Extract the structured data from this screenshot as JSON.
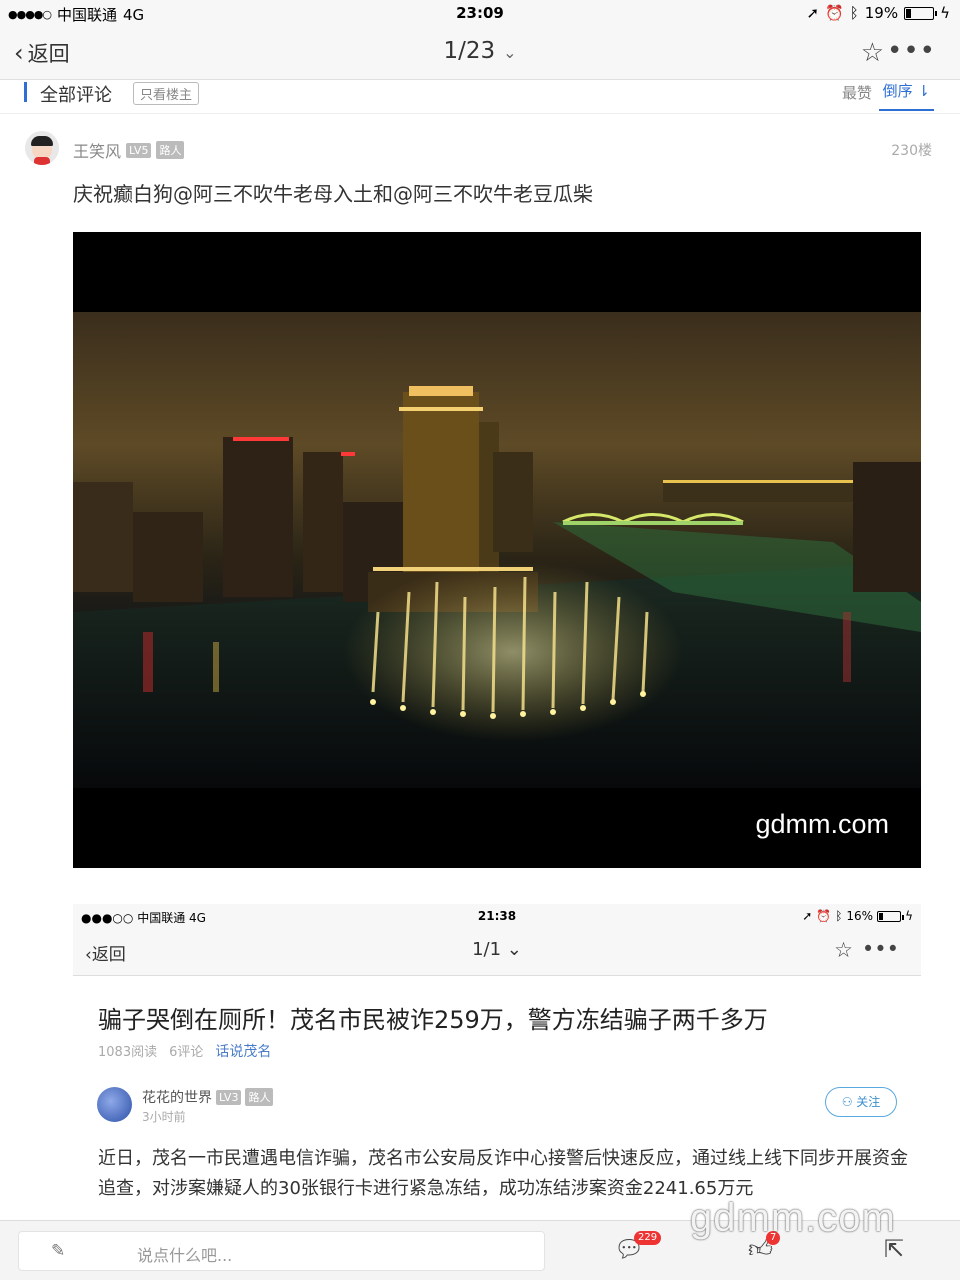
{
  "status_bar": {
    "signal_dots": "●●●●○",
    "carrier": "中国联通",
    "network": "4G",
    "time": "23:09",
    "battery_text": "19%",
    "battery_level": 0.19
  },
  "nav": {
    "back_label": "返回",
    "page_indicator": "1/23"
  },
  "comments_header": {
    "title": "全部评论",
    "op_only": "只看楼主",
    "sort_hot": "最赞",
    "sort_desc": "倒序"
  },
  "comment": {
    "username": "王笑风",
    "level": "LV5",
    "role": "路人",
    "floor": "230楼",
    "text": "庆祝癫白狗@阿三不吹牛老母入土和@阿三不吹牛老豆瓜柴"
  },
  "image": {
    "watermark": "gdmm.com"
  },
  "embedded_screenshot": {
    "status_bar": {
      "signal_dots": "●●●○○",
      "carrier": "中国联通",
      "network": "4G",
      "time": "21:38",
      "battery_text": "16%"
    },
    "nav": {
      "back_label": "返回",
      "page_indicator": "1/1"
    },
    "article_title": "骗子哭倒在厕所！茂名市民被诈259万，警方冻结骗子两千多万",
    "reads": "1083阅读",
    "comments": "6评论",
    "topic": "话说茂名",
    "author": "花花的世界",
    "author_level": "LV3",
    "author_role": "路人",
    "time_ago": "3小时前",
    "follow_label": "关注",
    "body": "近日，茂名一市民遭遇电信诈骗，茂名市公安局反诈中心接警后快速反应，通过线上线下同步开展资金追查，对涉案嫌疑人的30张银行卡进行紧急冻结，成功冻结涉案资金2241.65万元"
  },
  "bottom_bar": {
    "input_placeholder": "说点什么吧...",
    "comment_count": "229",
    "like_count": "7"
  },
  "watermark": "gdmm.com"
}
